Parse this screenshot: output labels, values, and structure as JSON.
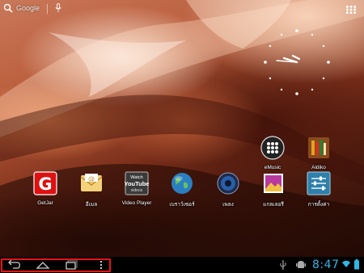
{
  "search": {
    "label": "Google"
  },
  "apps": [
    {
      "key": "getjar",
      "label": "GetJar",
      "icon": "getjar-icon",
      "glyph": "G",
      "color": "#cc1111"
    },
    {
      "key": "email",
      "label": "อีเมล",
      "icon": "email-icon",
      "glyph": "@",
      "color": "#f2c14e"
    },
    {
      "key": "video",
      "label": "Video Player",
      "icon": "youtube-video-icon",
      "glyph_top": "Watch",
      "glyph_mid": "YouTube",
      "glyph_bot": "videos",
      "color": "#333333"
    },
    {
      "key": "browser",
      "label": "เบราว์เซอร์",
      "icon": "globe-icon",
      "color": "#2a7fc0"
    },
    {
      "key": "music",
      "label": "เพลง",
      "icon": "speaker-icon",
      "color": "#2b5ea8"
    },
    {
      "key": "gallery",
      "label": "แกลเลอรี",
      "icon": "gallery-icon",
      "color": "#c040a0"
    },
    {
      "key": "settings",
      "label": "การตั้งค่า",
      "icon": "settings-sliders-icon",
      "color": "#3a8fb7"
    },
    {
      "key": "emusic",
      "label": "eMusic",
      "icon": "emusic-icon",
      "color": "#222222"
    },
    {
      "key": "aldiko",
      "label": "Aldiko",
      "icon": "books-icon",
      "color": "#7a3e1a"
    }
  ],
  "status": {
    "time": "8:47"
  },
  "colors": {
    "accent": "#33b5e5",
    "highlight": "#ee1111"
  }
}
